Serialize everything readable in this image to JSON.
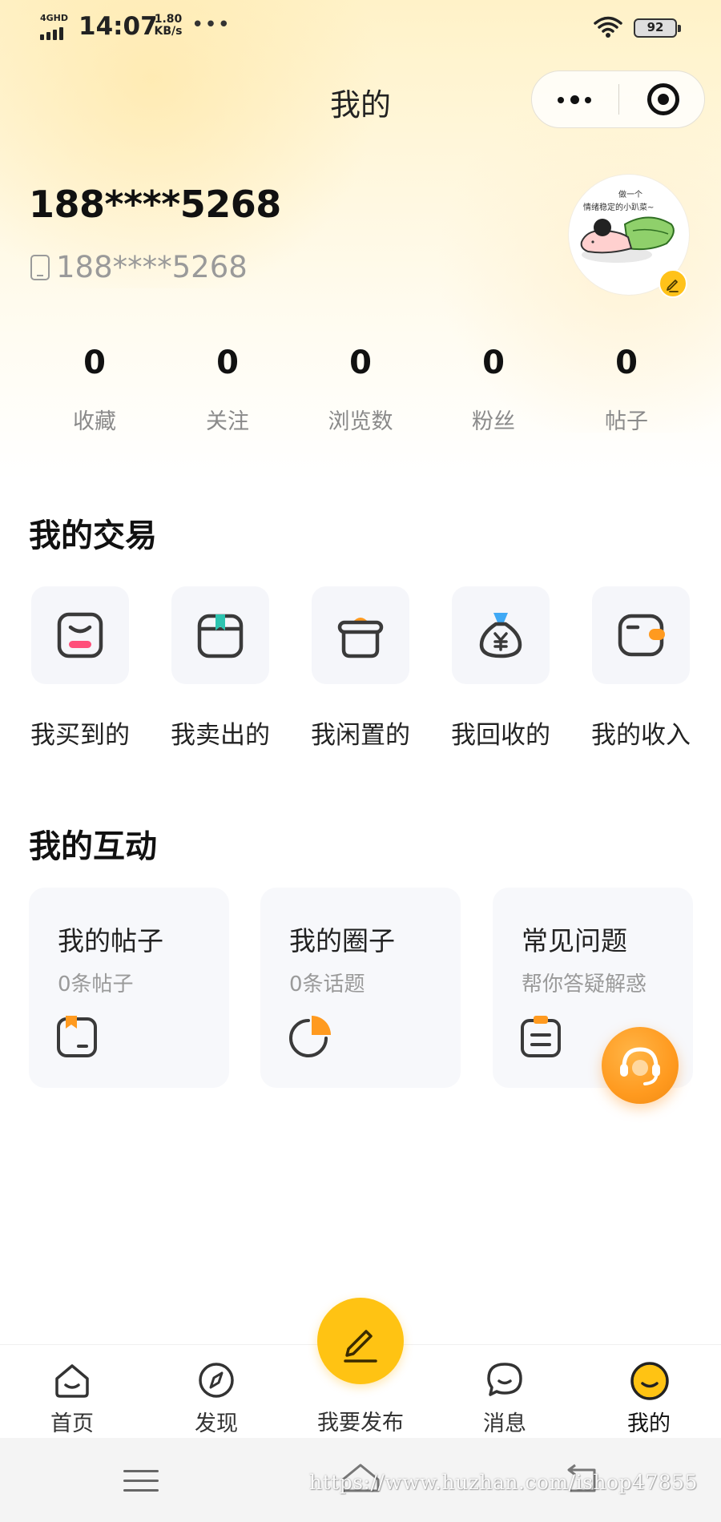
{
  "status_bar": {
    "network": "4GHD",
    "time": "14:07",
    "speed_value": "1.80",
    "speed_unit": "KB/s",
    "more": "•••",
    "battery": "92"
  },
  "header": {
    "title": "我的"
  },
  "profile": {
    "username": "188****5268",
    "phone": "188****5268",
    "avatar_caption": "做一个 情绪稳定的小趴菜~"
  },
  "stats": [
    {
      "value": "0",
      "label": "收藏"
    },
    {
      "value": "0",
      "label": "关注"
    },
    {
      "value": "0",
      "label": "浏览数"
    },
    {
      "value": "0",
      "label": "粉丝"
    },
    {
      "value": "0",
      "label": "帖子"
    }
  ],
  "trade_section": {
    "title": "我的交易",
    "items": [
      {
        "label": "我买到的",
        "icon": "bag-icon"
      },
      {
        "label": "我卖出的",
        "icon": "box-icon"
      },
      {
        "label": "我闲置的",
        "icon": "basket-icon"
      },
      {
        "label": "我回收的",
        "icon": "money-bag-icon"
      },
      {
        "label": "我的收入",
        "icon": "wallet-icon"
      }
    ]
  },
  "interaction_section": {
    "title": "我的互动",
    "cards": [
      {
        "title": "我的帖子",
        "subtitle": "0条帖子",
        "icon": "post-icon"
      },
      {
        "title": "我的圈子",
        "subtitle": "0条话题",
        "icon": "circle-chart-icon"
      },
      {
        "title": "常见问题",
        "subtitle": "帮你答疑解惑",
        "icon": "faq-clipboard-icon"
      }
    ]
  },
  "tabbar": {
    "items": [
      {
        "label": "首页",
        "icon": "home-icon"
      },
      {
        "label": "发现",
        "icon": "compass-icon"
      },
      {
        "label": "我要发布",
        "icon": "pen-icon"
      },
      {
        "label": "消息",
        "icon": "chat-icon"
      },
      {
        "label": "我的",
        "icon": "smile-icon"
      }
    ],
    "active": "我的"
  },
  "watermark": "https://www.huzhan.com/ishop47855",
  "colors": {
    "accent": "#ffc313",
    "orange": "#ff9a1f",
    "teal": "#2cc4b0",
    "pink": "#ff4f7a"
  }
}
